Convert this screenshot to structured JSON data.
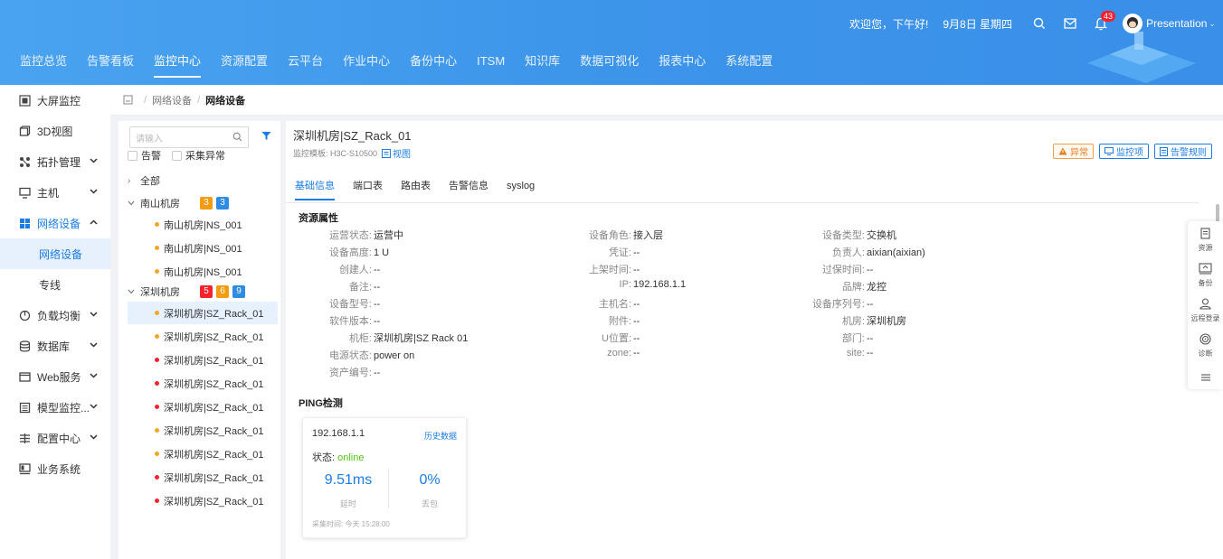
{
  "header": {
    "greeting": "欢迎您，下午好!",
    "date": "9月8日 星期四",
    "notification_count": "43",
    "user_name": "Presentation",
    "nav": [
      "监控总览",
      "告警看板",
      "监控中心",
      "资源配置",
      "云平台",
      "作业中心",
      "备份中心",
      "ITSM",
      "知识库",
      "数据可视化",
      "报表中心",
      "系统配置"
    ],
    "active_nav_index": 2
  },
  "sidebar": {
    "items": [
      {
        "label": "大屏监控",
        "icon": "screen-icon",
        "chevron": false
      },
      {
        "label": "3D视图",
        "icon": "cube-icon",
        "chevron": false
      },
      {
        "label": "拓扑管理",
        "icon": "topology-icon",
        "chevron": true
      },
      {
        "label": "主机",
        "icon": "monitor-icon",
        "chevron": true
      },
      {
        "label": "网络设备",
        "icon": "network-icon",
        "chevron": true,
        "open": true
      },
      {
        "label": "负载均衡",
        "icon": "balance-icon",
        "chevron": true
      },
      {
        "label": "数据库",
        "icon": "database-icon",
        "chevron": true
      },
      {
        "label": "Web服务",
        "icon": "web-icon",
        "chevron": true
      },
      {
        "label": "模型监控...",
        "icon": "model-icon",
        "chevron": true
      },
      {
        "label": "配置中心",
        "icon": "config-icon",
        "chevron": true
      },
      {
        "label": "业务系统",
        "icon": "business-icon",
        "chevron": false
      }
    ],
    "sub_items": [
      "网络设备",
      "专线"
    ]
  },
  "breadcrumb": {
    "items": [
      "网络设备",
      "网络设备"
    ]
  },
  "tree": {
    "search_placeholder": "请输入",
    "check_alarm": "告警",
    "check_collect": "采集异常",
    "all_label": "全部",
    "groups": [
      {
        "name": "南山机房",
        "counts": [
          "3",
          "3"
        ],
        "count_colors": [
          "#f39c12",
          "#2e8be6"
        ],
        "children": [
          {
            "name": "南山机房|NS_001",
            "status": "#f5a623"
          },
          {
            "name": "南山机房|NS_001",
            "status": "#f5a623"
          },
          {
            "name": "南山机房|NS_001",
            "status": "#f5a623"
          }
        ]
      },
      {
        "name": "深圳机房",
        "counts": [
          "5",
          "6",
          "9"
        ],
        "count_colors": [
          "#f5222d",
          "#f39c12",
          "#2e8be6"
        ],
        "children": [
          {
            "name": "深圳机房|SZ_Rack_01",
            "status": "#f5a623",
            "selected": true
          },
          {
            "name": "深圳机房|SZ_Rack_01",
            "status": "#f5a623"
          },
          {
            "name": "深圳机房|SZ_Rack_01",
            "status": "#f5222d"
          },
          {
            "name": "深圳机房|SZ_Rack_01",
            "status": "#f5222d"
          },
          {
            "name": "深圳机房|SZ_Rack_01",
            "status": "#f5222d"
          },
          {
            "name": "深圳机房|SZ_Rack_01",
            "status": "#f5a623"
          },
          {
            "name": "深圳机房|SZ_Rack_01",
            "status": "#f5a623"
          },
          {
            "name": "深圳机房|SZ_Rack_01",
            "status": "#f5222d"
          },
          {
            "name": "深圳机房|SZ_Rack_01",
            "status": "#f5222d"
          }
        ]
      }
    ]
  },
  "device": {
    "title": "深圳机房|SZ_Rack_01",
    "template_label": "监控模板: H3C-S10500",
    "view_link": "视图",
    "btn_abnormal": "异常",
    "btn_monitor": "监控项",
    "btn_alarm_rules": "告警规则",
    "tabs": [
      "基础信息",
      "端口表",
      "路由表",
      "告警信息",
      "syslog"
    ],
    "active_tab_index": 0,
    "section_attrs": "资源属性",
    "attributes": [
      [
        {
          "k": "运营状态:",
          "v": "运营中"
        },
        {
          "k": "设备角色:",
          "v": "接入层"
        },
        {
          "k": "设备类型:",
          "v": "交换机"
        }
      ],
      [
        {
          "k": "设备高度:",
          "v": "1 U"
        },
        {
          "k": "凭证:",
          "v": "--"
        },
        {
          "k": "负责人:",
          "v": "aixian(aixian)"
        }
      ],
      [
        {
          "k": "创建人:",
          "v": "--"
        },
        {
          "k": "上架时间:",
          "v": "--"
        },
        {
          "k": "过保时间:",
          "v": "--"
        }
      ],
      [
        {
          "k": "备注:",
          "v": "--"
        },
        {
          "k": "IP:",
          "v": "192.168.1.1"
        },
        {
          "k": "品牌:",
          "v": "龙控"
        }
      ],
      [
        {
          "k": "设备型号:",
          "v": "--"
        },
        {
          "k": "主机名:",
          "v": "--"
        },
        {
          "k": "设备序列号:",
          "v": "--"
        }
      ],
      [
        {
          "k": "软件版本:",
          "v": "--"
        },
        {
          "k": "附件:",
          "v": "--"
        },
        {
          "k": "机房:",
          "v": "深圳机房"
        }
      ],
      [
        {
          "k": "机柜:",
          "v": "深圳机房|SZ Rack 01"
        },
        {
          "k": "U位置:",
          "v": "--"
        },
        {
          "k": "部门:",
          "v": "--"
        }
      ],
      [
        {
          "k": "电源状态:",
          "v": "power on"
        },
        {
          "k": "zone:",
          "v": "--"
        },
        {
          "k": "site:",
          "v": "--"
        }
      ],
      [
        {
          "k": "资产编号:",
          "v": "--"
        }
      ]
    ],
    "section_ping": "PING检测",
    "ping": {
      "ip": "192.168.1.1",
      "history": "历史数据",
      "status_label": "状态:",
      "status_value": "online",
      "latency": "9.51ms",
      "latency_label": "延时",
      "loss": "0%",
      "loss_label": "丢包",
      "collect_time": "采集时间: 今天 15:28:00"
    }
  },
  "right_tools": [
    {
      "label": "资源",
      "icon": "resource-icon"
    },
    {
      "label": "备份",
      "icon": "backup-icon"
    },
    {
      "label": "远程登录",
      "icon": "remote-login-icon"
    },
    {
      "label": "诊断",
      "icon": "diagnose-icon"
    }
  ],
  "colors": {
    "primary": "#1c7ce6",
    "header": "#3d95ea",
    "warning": "#f5a623",
    "danger": "#f5222d",
    "online": "#52c41a"
  }
}
